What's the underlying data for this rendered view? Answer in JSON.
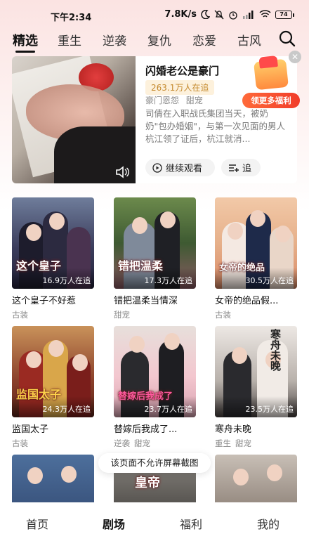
{
  "status_bar": {
    "time": "下午2:34",
    "network_speed": "7.8K/s",
    "battery_level": "74"
  },
  "category_tabs": [
    {
      "label": "精选",
      "active": true
    },
    {
      "label": "重生",
      "active": false
    },
    {
      "label": "逆袭",
      "active": false
    },
    {
      "label": "复仇",
      "active": false
    },
    {
      "label": "恋爱",
      "active": false
    },
    {
      "label": "古风",
      "active": false
    }
  ],
  "featured": {
    "title": "闪婚老公是豪门",
    "viewers": "263.1万人在追",
    "tags": [
      "豪门恩怨",
      "甜宠"
    ],
    "description": "司倩在入职战氏集团当天，被奶奶\"包办婚姻\"，与第一次见面的男人杭江领了证后，杭江就消...",
    "watch_label": "继续观看",
    "follow_label": "追",
    "promo_label": "领更多福利"
  },
  "dramas": [
    {
      "title": "这个皇子不好惹",
      "cover_title": "这个皇子",
      "count": "16.9万人在追",
      "tags": [
        "古装"
      ]
    },
    {
      "title": "错把温柔当情深",
      "cover_title": "错把温柔",
      "count": "17.3万人在追",
      "tags": [
        "甜宠"
      ]
    },
    {
      "title": "女帝的绝品假...",
      "cover_title": "女帝的绝品",
      "count": "30.5万人在追",
      "tags": [
        "古装"
      ]
    },
    {
      "title": "监国太子",
      "cover_title": "监国太子",
      "count": "24.3万人在追",
      "tags": [
        "古装"
      ]
    },
    {
      "title": "替嫁后我成了...",
      "cover_title": "替嫁后我成了",
      "count": "23.7万人在追",
      "tags": [
        "逆袭",
        "甜宠"
      ]
    },
    {
      "title": "寒舟未晚",
      "cover_title": "寒舟未晚",
      "count": "23.5万人在追",
      "tags": [
        "重生",
        "甜宠"
      ]
    }
  ],
  "partial_row": {
    "cover_title": "皇帝"
  },
  "toast": "该页面不允许屏幕截图",
  "bottom_nav": [
    {
      "label": "首页",
      "active": false
    },
    {
      "label": "剧场",
      "active": true
    },
    {
      "label": "福利",
      "active": false
    },
    {
      "label": "我的",
      "active": false
    }
  ]
}
